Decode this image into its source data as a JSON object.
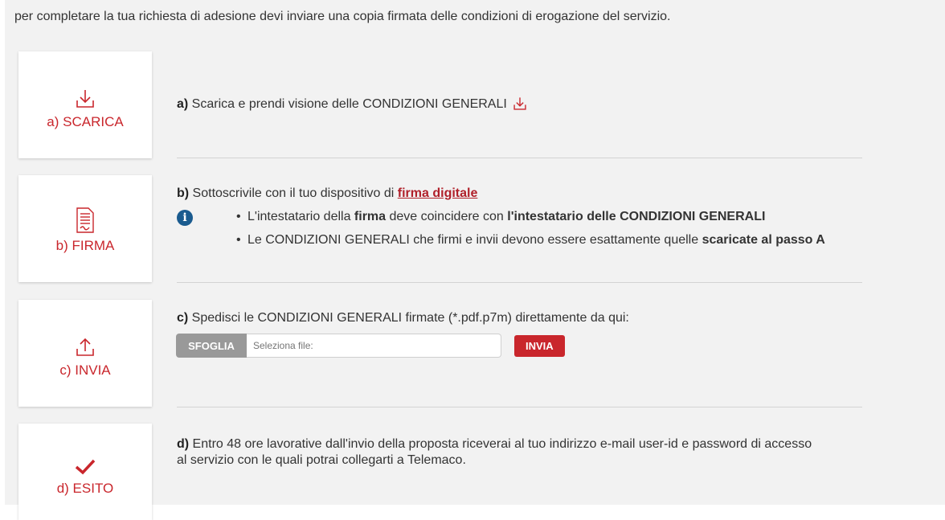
{
  "intro": "per completare la tua richiesta di adesione devi inviare una copia firmata delle condizioni di erogazione del servizio.",
  "colors": {
    "accent": "#c9262c",
    "info": "#1a5b8f",
    "background": "#f2f2f2"
  },
  "steps": [
    {
      "card_label": "a) SCARICA",
      "icon": "download-icon"
    },
    {
      "card_label": "b) FIRMA",
      "icon": "document-sign-icon"
    },
    {
      "card_label": "c) INVIA",
      "icon": "upload-icon"
    },
    {
      "card_label": "d) ESITO",
      "icon": "checkmark-icon"
    }
  ],
  "step_a": {
    "prefix": "a)",
    "text": " Scarica e prendi visione delle CONDIZIONI GENERALI"
  },
  "step_b": {
    "prefix": "b)",
    "text": " Sottoscrivile con il tuo dispositivo di ",
    "link": "firma digitale",
    "bullets": [
      {
        "t1": "L'intestatario della ",
        "b1": "firma",
        "t2": " deve coincidere con ",
        "b2": "l'intestatario delle CONDIZIONI GENERALI"
      },
      {
        "t1": "Le CONDIZIONI GENERALI che firmi e invii devono essere esattamente quelle ",
        "b1": "scaricate al passo A"
      }
    ]
  },
  "step_c": {
    "prefix": "c)",
    "text": " Spedisci le CONDIZIONI GENERALI firmate (*.pdf.p7m) direttamente da qui:",
    "browse_label": "SFOGLIA",
    "file_placeholder": "Seleziona file:",
    "send_label": "INVIA"
  },
  "step_d": {
    "prefix": "d)",
    "line1": " Entro 48 ore lavorative dall'invio della proposta riceverai al tuo indirizzo e-mail user-id e password di accesso",
    "line2": "al servizio con le quali potrai collegarti a Telemaco."
  }
}
